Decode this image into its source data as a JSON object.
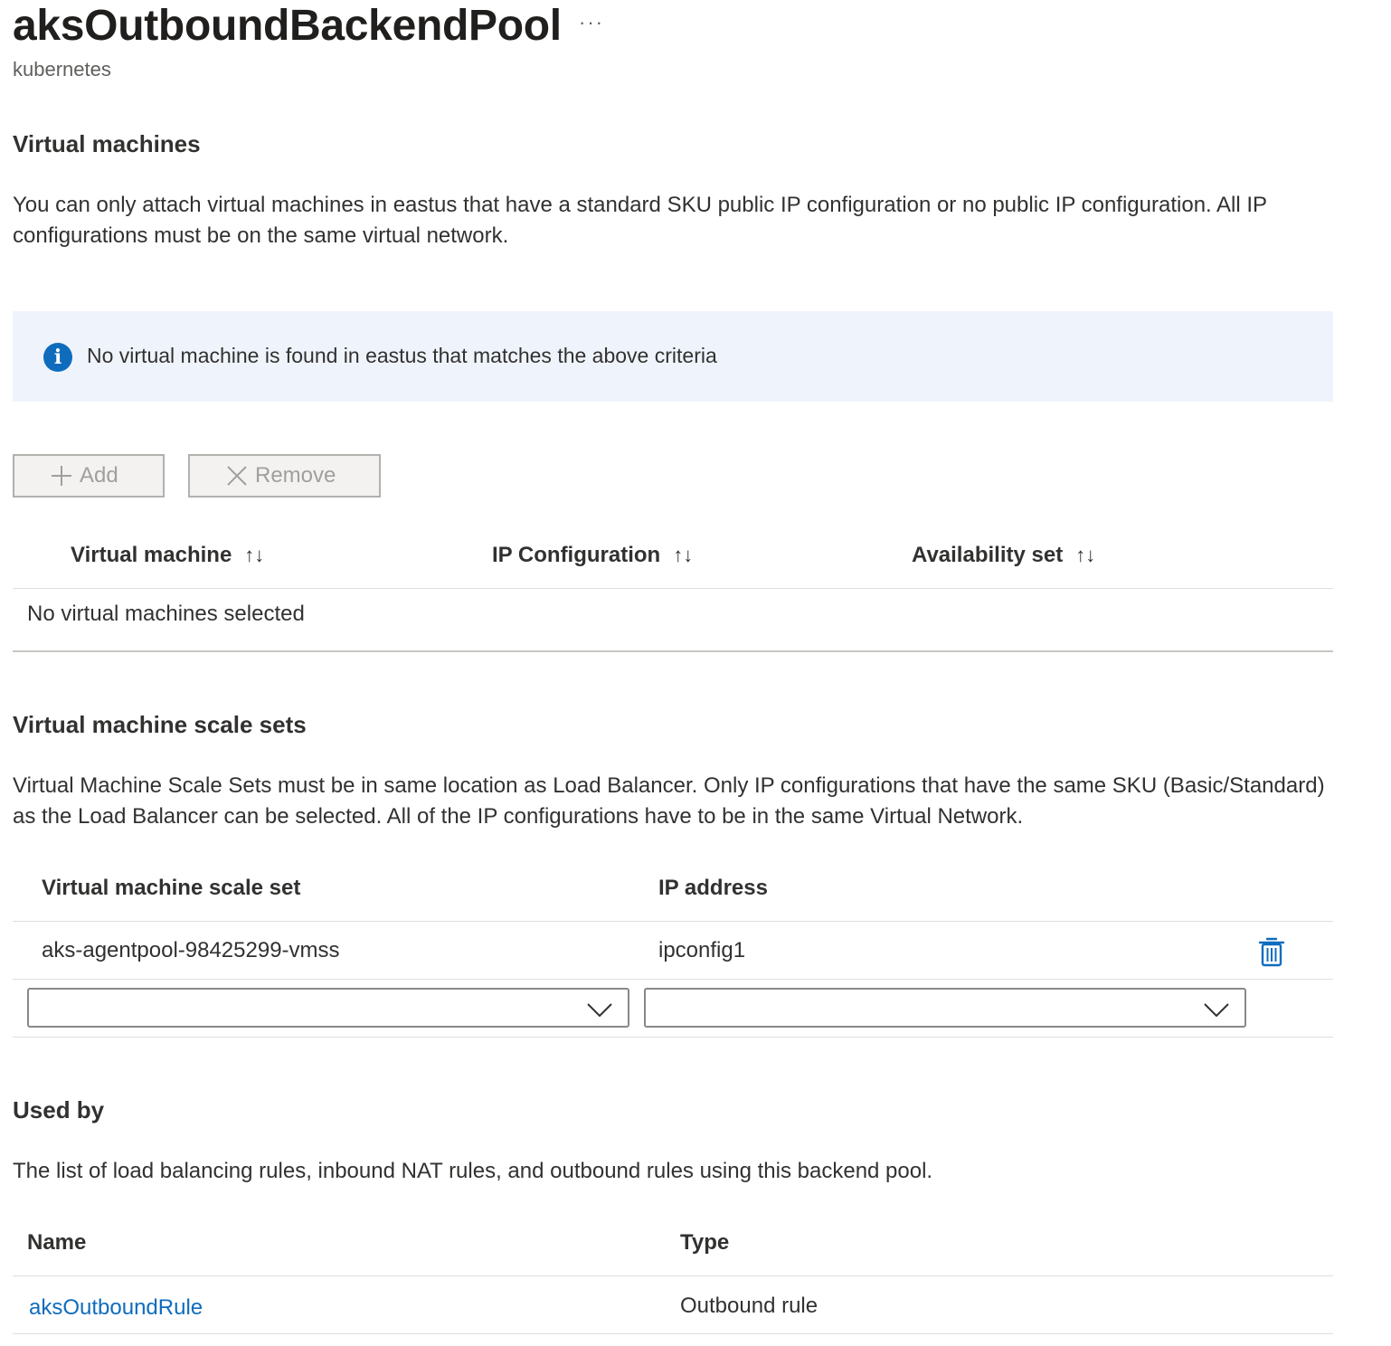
{
  "header": {
    "title": "aksOutboundBackendPool",
    "more_label": "···",
    "subtitle": "kubernetes"
  },
  "vm_section": {
    "heading": "Virtual machines",
    "description": "You can only attach virtual machines in eastus that have a standard SKU public IP configuration or no public IP configuration. All IP configurations must be on the same virtual network.",
    "info_message": "No virtual machine is found in eastus that matches the above criteria",
    "add_label": "Add",
    "remove_label": "Remove",
    "columns": [
      "Virtual machine",
      "IP Configuration",
      "Availability set"
    ],
    "sort_glyph": "↑↓",
    "empty_text": "No virtual machines selected"
  },
  "vmss_section": {
    "heading": "Virtual machine scale sets",
    "description": "Virtual Machine Scale Sets must be in same location as Load Balancer. Only IP configurations that have the same SKU (Basic/Standard) as the Load Balancer can be selected. All of the IP configurations have to be in the same Virtual Network.",
    "columns": [
      "Virtual machine scale set",
      "IP address"
    ],
    "rows": [
      {
        "scale_set": "aks-agentpool-98425299-vmss",
        "ip": "ipconfig1"
      }
    ],
    "new_row": {
      "scale_set_value": "",
      "ip_value": ""
    }
  },
  "used_by": {
    "heading": "Used by",
    "description": "The list of load balancing rules, inbound NAT rules, and outbound rules using this backend pool.",
    "columns": [
      "Name",
      "Type"
    ],
    "rows": [
      {
        "name": "aksOutboundRule",
        "type": "Outbound rule"
      }
    ]
  },
  "colors": {
    "accent": "#0f6cbd",
    "info_bg": "#eff4fc",
    "text": "#323130",
    "divider": "#e1dfdd"
  },
  "icons": [
    "more-icon",
    "info-icon",
    "add-icon",
    "remove-icon",
    "sort-icon",
    "chevron-down-icon",
    "trash-icon"
  ]
}
